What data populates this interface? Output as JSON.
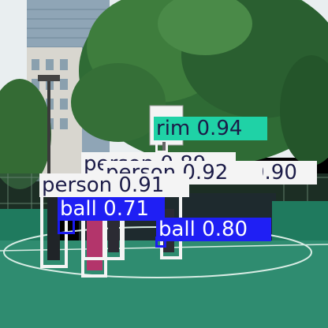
{
  "image": {
    "description_class": "basketball-court-object-detection"
  },
  "colors": {
    "person_box": "#f4f4f4",
    "rim_label": "#1fd2a6",
    "ball_label": "#1f1ff4",
    "label_text_dark": "#1c1c48",
    "label_text_light": "#ffffff"
  },
  "detections": [
    {
      "cls": "rim",
      "score": "0.94"
    },
    {
      "cls": "person",
      "score": "0.89"
    },
    {
      "cls": "person",
      "score": "0.92"
    },
    {
      "cls": "person",
      "score": "0.90"
    },
    {
      "cls": "person",
      "score": "0.91"
    },
    {
      "cls": "ball",
      "score": "0.71"
    },
    {
      "cls": "ball",
      "score": "0.80"
    }
  ]
}
